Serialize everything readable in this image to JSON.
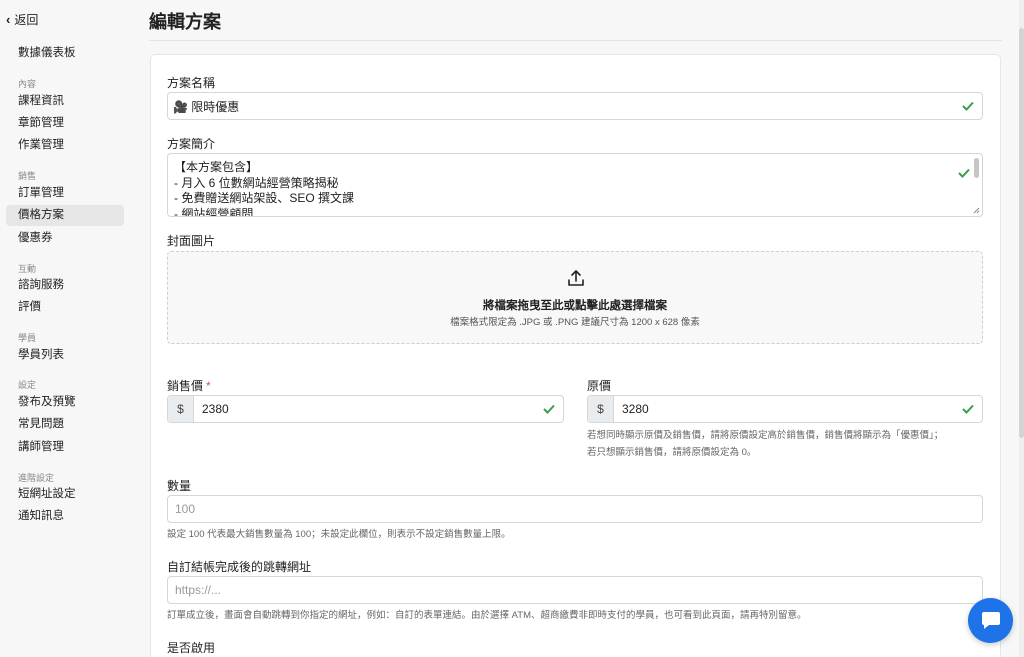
{
  "sidebar": {
    "back_label": "返回",
    "dashboard": "數據儀表板",
    "sections": {
      "content": "內容",
      "sales": "銷售",
      "interaction": "互動",
      "students": "學員",
      "settings": "設定",
      "advanced": "進階設定"
    },
    "items": {
      "course_info": "課程資訊",
      "chapters": "章節管理",
      "assignments": "作業管理",
      "orders": "訂單管理",
      "pricing": "價格方案",
      "coupons": "優惠券",
      "consult": "諮詢服務",
      "reviews": "評價",
      "student_list": "學員列表",
      "publish": "發布及預覽",
      "faq": "常見問題",
      "instructors": "講師管理",
      "short_url": "短網址設定",
      "notifications": "通知訊息"
    }
  },
  "page": {
    "title": "編輯方案"
  },
  "form": {
    "plan_name_label": "方案名稱",
    "plan_name_value": "🎥 限時優惠",
    "summary_label": "方案簡介",
    "summary_lines": "【本方案包含】\n- 月入 6 位數網站經營策略揭秘\n- 免費贈送網站架設、SEO 撰文課\n- 網站經營顧問",
    "cover_label": "封面圖片",
    "dropzone_title": "將檔案拖曳至此或點擊此處選擇檔案",
    "dropzone_hint": "檔案格式限定為 .JPG 或 .PNG 建議尺寸為 1200 x 628 像素",
    "sale_price_label": "銷售價",
    "required_mark": "*",
    "currency": "$",
    "sale_price_value": "2380",
    "original_price_label": "原價",
    "original_price_value": "3280",
    "original_price_help_1": "若想同時顯示原價及銷售價，請將原價設定高於銷售價，銷售價將顯示為「優惠價」；",
    "original_price_help_2": "若只想顯示銷售價，請將原價設定為 0。",
    "quantity_label": "數量",
    "quantity_placeholder": "100",
    "quantity_help": "設定 100 代表最大銷售數量為 100；未設定此欄位，則表示不設定銷售數量上限。",
    "redirect_label": "自訂結帳完成後的跳轉網址",
    "redirect_placeholder": "https://...",
    "redirect_help": "訂單成立後，畫面會自動跳轉到你指定的網址，例如：自訂的表單連結。由於選擇 ATM、超商繳費非即時支付的學員，也可看到此頁面，請再特別留意。",
    "enabled_label": "是否啟用"
  },
  "colors": {
    "valid_check": "#3a9d4a",
    "chat_button": "#1e73e8",
    "required": "#d9534f"
  }
}
